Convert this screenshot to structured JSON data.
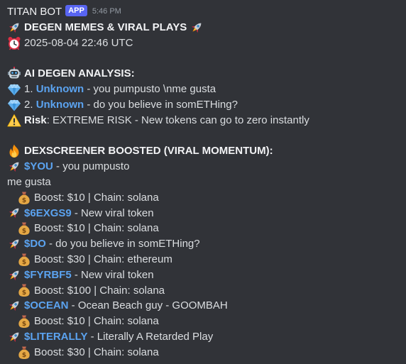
{
  "header": {
    "username": "TITAN BOT",
    "badge": "APP",
    "timestamp": "5:46 PM"
  },
  "title": "DEGEN MEMES & VIRAL PLAYS",
  "datetime": "2025-08-04 22:46 UTC",
  "ai_section": {
    "heading": "AI DEGEN ANALYSIS:",
    "items": [
      {
        "num": "1. ",
        "name": "Unknown",
        "desc": " - you pumpusto \\nme gusta"
      },
      {
        "num": "2. ",
        "name": "Unknown",
        "desc": " - do you believe in somETHing?"
      }
    ],
    "risk_label": "Risk",
    "risk_text": ": EXTREME RISK - New tokens can go to zero instantly"
  },
  "dex_section": {
    "heading": "DEXSCREENER BOOSTED (VIRAL MOMENTUM):",
    "tokens": [
      {
        "ticker": "$YOU",
        "desc": " - you pumpusto",
        "extra": "me gusta",
        "boost": "Boost: $10 | Chain: solana"
      },
      {
        "ticker": "$6EXGS9",
        "desc": " - New viral token",
        "boost": "Boost: $10 | Chain: solana"
      },
      {
        "ticker": "$DO",
        "desc": " - do you believe in somETHing?",
        "boost": "Boost: $30 | Chain: ethereum"
      },
      {
        "ticker": "$FYRBF5",
        "desc": " - New viral token",
        "boost": "Boost: $100 | Chain: solana"
      },
      {
        "ticker": "$OCEAN",
        "desc": " - Ocean Beach guy - GOOMBAH",
        "boost": "Boost: $10 | Chain: solana"
      },
      {
        "ticker": "$LITERALLY",
        "desc": " - Literally A Retarded Play",
        "boost": "Boost: $30 | Chain: solana"
      }
    ]
  },
  "icons": {
    "rocket": "rocket-icon",
    "clock": "alarm-clock-icon",
    "robot": "robot-icon",
    "gem": "gem-icon",
    "warning": "warning-icon",
    "fire": "fire-icon",
    "money": "money-bag-icon"
  },
  "colors": {
    "background": "#313338",
    "text": "#dbdee1",
    "link": "#5ba3f0",
    "badge": "#5865f2",
    "timestamp": "#949ba4"
  }
}
